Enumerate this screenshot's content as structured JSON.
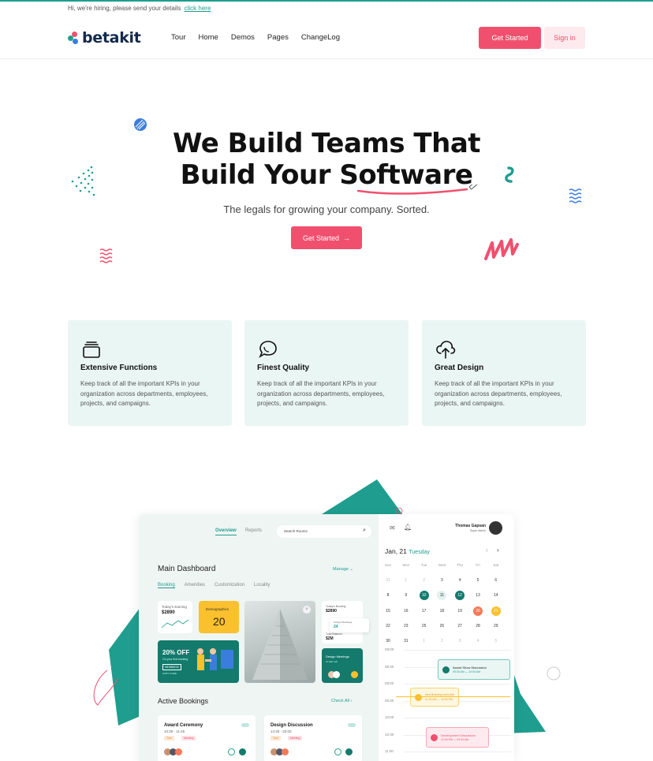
{
  "topbar": {
    "hiring_text": "Hi, we're hiring, please send your details",
    "hiring_link": "click here"
  },
  "brand": {
    "name": "betakit",
    "colors": {
      "accent": "#f0506e",
      "teal": "#1f9e8f",
      "navy": "#13294b",
      "feature_bg": "#eaf6f3"
    }
  },
  "nav": {
    "items": [
      "Tour",
      "Home",
      "Demos",
      "Pages",
      "ChangeLog"
    ],
    "get_started": "Get Started",
    "sign_in": "Sign in"
  },
  "hero": {
    "title_line1": "We Build Teams That",
    "title_line2_a": "Build Your ",
    "title_line2_b": "Software",
    "subtitle": "The legals for growing your company. Sorted.",
    "cta": "Get Started",
    "cta_icon": "arrow-right-icon"
  },
  "features": [
    {
      "icon": "layers-icon",
      "title": "Extensive Functions",
      "desc": "Keep track of all the important KPIs in your organization across departments, employees, projects, and campaigns."
    },
    {
      "icon": "chat-bubbles-icon",
      "title": "Finest Quality",
      "desc": "Keep track of all the important KPIs in your organization across departments, employees, projects, and campaigns."
    },
    {
      "icon": "cloud-upload-icon",
      "title": "Great Design",
      "desc": "Keep track of all the important KPIs in your organization across departments, employees, projects, and campaigns."
    }
  ],
  "dashboard": {
    "tabs": [
      "Overview",
      "Reports"
    ],
    "search_placeholder": "Search Rooms",
    "title": "Main Dashboard",
    "manage": "Manage",
    "subtabs": [
      "Booking",
      "Amenities",
      "Customization",
      "Locality"
    ],
    "card_earning_label": "Today's Earning",
    "card_earning_value": "$2890",
    "card_demo_label": "Demographics",
    "card_demo_value": "20",
    "promo_title": "20% OFF",
    "promo_sub": "On your first booking",
    "promo_code": "NEWBIE20",
    "promo_copy": "COPY CODE",
    "mini_booking_label": "Today's Booking",
    "mini_booking_value": "$2890",
    "mini_bookings_label": "Today's Bookings",
    "mini_bookings_value": "24",
    "mini_total_label": "Total Balance",
    "mini_total_value": "$2M",
    "meeting_title": "Design Meetings",
    "meeting_sub": "11 Mar Left",
    "active_title": "Active Bookings",
    "check_all": "Check All",
    "bookings": [
      {
        "title": "Award Ceremony",
        "time": "10:30 - 11:45",
        "tags": [
          "Tour",
          "Meeting"
        ]
      },
      {
        "title": "Design Discussion",
        "time": "14:30 - 20:00",
        "tags": [
          "Tour",
          "Meeting"
        ]
      }
    ],
    "user_name": "Thomas Gapsan",
    "user_role": "Super Admin",
    "date": "Jan, 21",
    "day": "Tuesday",
    "weekdays": [
      "Sun",
      "Mon",
      "Tue",
      "Wed",
      "Thu",
      "Fri",
      "Sat"
    ],
    "weeks": [
      [
        "31",
        "1",
        "2",
        "3",
        "4",
        "5",
        "6"
      ],
      [
        "8",
        "9",
        "10",
        "11",
        "12",
        "13",
        "14"
      ],
      [
        "15",
        "16",
        "17",
        "18",
        "19",
        "20",
        "21"
      ],
      [
        "22",
        "23",
        "25",
        "26",
        "27",
        "28",
        "29"
      ],
      [
        "30",
        "31",
        "1",
        "2",
        "3",
        "4",
        "5"
      ]
    ],
    "times": [
      "08:00",
      "08:30",
      "09:00",
      "09:30",
      "10:00",
      "10:30",
      "11:00"
    ],
    "events": [
      {
        "title": "Award Show Discussion",
        "time": "09:30 AM — 10:00 AM"
      },
      {
        "title": "New Branding work Alet",
        "time": "11:30 AM — 10:30 PM"
      },
      {
        "title": "Development Discussion",
        "time": "12:00 PM — 03:30 AM"
      }
    ]
  }
}
